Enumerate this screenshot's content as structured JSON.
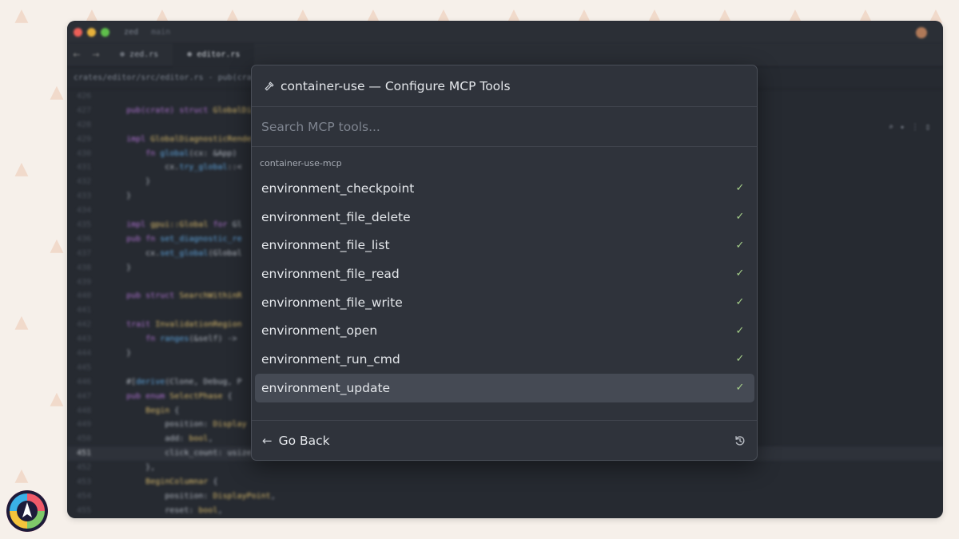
{
  "editor": {
    "window_title": "zed",
    "branch": "main",
    "tabs": [
      "zed.rs",
      "editor.rs"
    ],
    "path": "crates/editor/src/editor.rs - pub(crate)"
  },
  "modal": {
    "title": "container-use — Configure MCP Tools",
    "search_placeholder": "Search MCP tools...",
    "group_label": "container-use-mcp",
    "tools": [
      {
        "name": "environment_checkpoint",
        "enabled": true,
        "selected": false
      },
      {
        "name": "environment_file_delete",
        "enabled": true,
        "selected": false
      },
      {
        "name": "environment_file_list",
        "enabled": true,
        "selected": false
      },
      {
        "name": "environment_file_read",
        "enabled": true,
        "selected": false
      },
      {
        "name": "environment_file_write",
        "enabled": true,
        "selected": false
      },
      {
        "name": "environment_open",
        "enabled": true,
        "selected": false
      },
      {
        "name": "environment_run_cmd",
        "enabled": true,
        "selected": false
      },
      {
        "name": "environment_update",
        "enabled": true,
        "selected": true
      }
    ],
    "footer": {
      "back_label": "Go Back"
    }
  },
  "icons": {
    "title": "hammer-icon",
    "check": "check-icon",
    "back": "arrow-left-icon",
    "reset": "reset-icon"
  },
  "colors": {
    "page_background": "#f6f0ea",
    "modal_background": "#2f333b",
    "selected_row": "#454a54",
    "check": "#a6d08a"
  }
}
